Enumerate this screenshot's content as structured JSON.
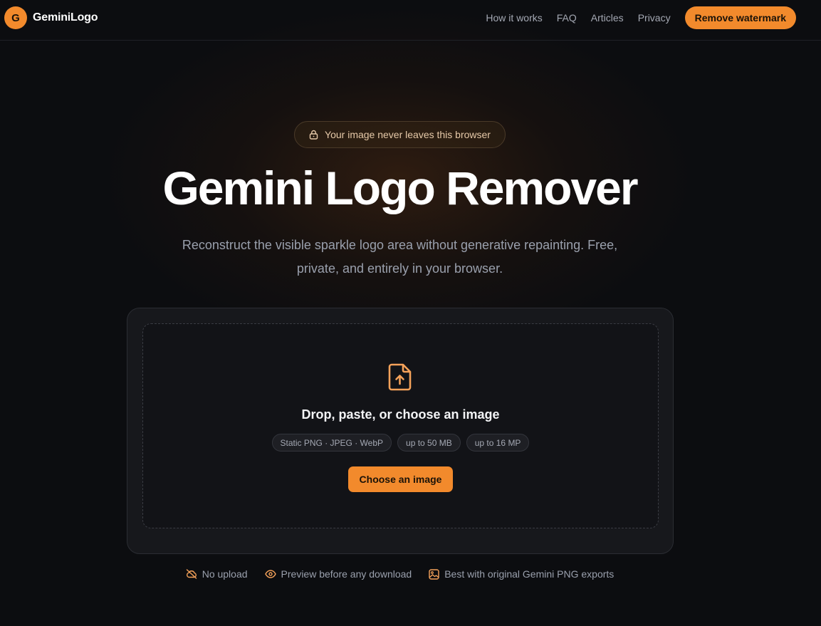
{
  "colors": {
    "accent": "#f28a2c",
    "background": "#0c0d10"
  },
  "nav": {
    "brand_initial": "G",
    "brand_name": "GeminiLogo",
    "links": [
      "How it works",
      "FAQ",
      "Articles",
      "Privacy"
    ],
    "cta": "Remove watermark"
  },
  "hero": {
    "badge_icon": "lock-icon",
    "badge": "Your image never leaves this browser",
    "title": "Gemini Logo Remover",
    "subtitle": "Reconstruct the visible sparkle logo area without generative repainting. Free, private, and entirely in your browser."
  },
  "uploader": {
    "icon": "file-upload-icon",
    "title": "Drop, paste, or choose an image",
    "chips": [
      "Static PNG · JPEG · WebP",
      "up to 50 MB",
      "up to 16 MP"
    ],
    "button": "Choose an image"
  },
  "features": [
    {
      "icon": "cloud-off-icon",
      "label": "No upload"
    },
    {
      "icon": "eye-icon",
      "label": "Preview before any download"
    },
    {
      "icon": "image-icon",
      "label": "Best with original Gemini PNG exports"
    }
  ]
}
